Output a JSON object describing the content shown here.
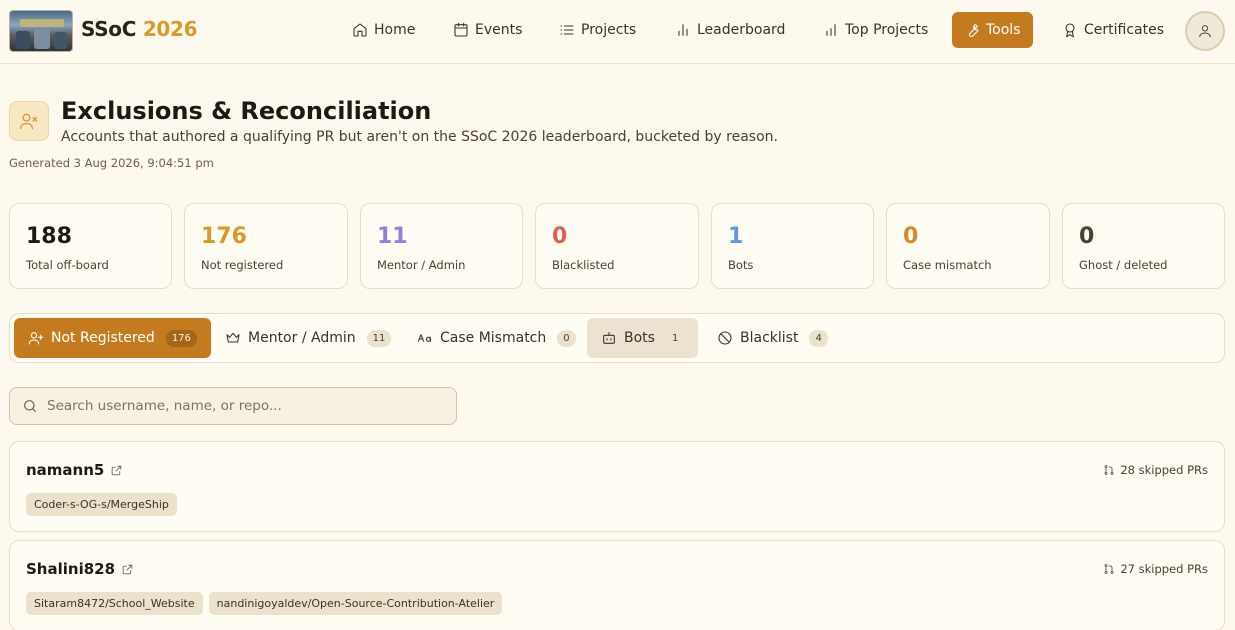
{
  "header": {
    "brand_name": "SSoC",
    "brand_year": "2026",
    "nav": [
      {
        "label": "Home",
        "icon": "home-icon"
      },
      {
        "label": "Events",
        "icon": "calendar-icon"
      },
      {
        "label": "Projects",
        "icon": "list-icon"
      },
      {
        "label": "Leaderboard",
        "icon": "bar-chart-icon"
      },
      {
        "label": "Top Projects",
        "icon": "bar-chart-icon"
      },
      {
        "label": "Tools",
        "icon": "wrench-icon",
        "active": true
      },
      {
        "label": "Certificates",
        "icon": "award-icon"
      }
    ]
  },
  "page": {
    "title": "Exclusions & Reconciliation",
    "subtitle": "Accounts that authored a qualifying PR but aren't on the SSoC 2026 leaderboard, bucketed by reason.",
    "generated": "Generated 3 Aug 2026, 9:04:51 pm"
  },
  "stats": [
    {
      "value": "188",
      "label": "Total off-board",
      "color": "#1e1912"
    },
    {
      "value": "176",
      "label": "Not registered",
      "color": "#d99a27"
    },
    {
      "value": "11",
      "label": "Mentor / Admin",
      "color": "#9a7ce0"
    },
    {
      "value": "0",
      "label": "Blacklisted",
      "color": "#d9634f"
    },
    {
      "value": "1",
      "label": "Bots",
      "color": "#5c9be0"
    },
    {
      "value": "0",
      "label": "Case mismatch",
      "color": "#d9892a"
    },
    {
      "value": "0",
      "label": "Ghost / deleted",
      "color": "#4a4132"
    }
  ],
  "tabs": [
    {
      "label": "Not Registered",
      "count": "176",
      "icon": "user-plus-icon",
      "state": "active"
    },
    {
      "label": "Mentor / Admin",
      "count": "11",
      "icon": "crown-icon"
    },
    {
      "label": "Case Mismatch",
      "count": "0",
      "icon": "case-icon"
    },
    {
      "label": "Bots",
      "count": "1",
      "icon": "bot-icon",
      "state": "hover"
    },
    {
      "label": "Blacklist",
      "count": "4",
      "icon": "ban-icon"
    }
  ],
  "search": {
    "placeholder": "Search username, name, or repo..."
  },
  "rows": [
    {
      "username": "namann5",
      "skipped": "28 skipped PRs",
      "repos": [
        "Coder-s-OG-s/MergeShip"
      ]
    },
    {
      "username": "Shalini828",
      "skipped": "27 skipped PRs",
      "repos": [
        "Sitaram8472/School_Website",
        "nandinigoyaldev/Open-Source-Contribution-Atelier"
      ]
    }
  ],
  "colors": {
    "accent": "#c47b1f",
    "background": "#fdf9ee"
  }
}
